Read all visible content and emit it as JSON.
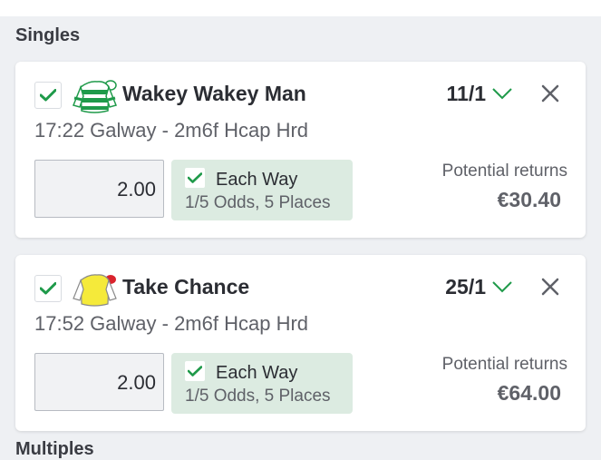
{
  "sections": {
    "singles_title": "Singles",
    "multiples_title": "Multiples"
  },
  "colors": {
    "accent_green": "#1f9a4a",
    "each_way_bg": "#dcebe1",
    "card_bg": "#ffffff",
    "page_bg": "#eef0f3"
  },
  "bets": [
    {
      "selected": true,
      "horse": "Wakey Wakey Man",
      "odds": "11/1",
      "race": "17:22 Galway - 2m6f Hcap Hrd",
      "stake": "2.00",
      "each_way": {
        "checked": true,
        "label": "Each Way",
        "terms": "1/5 Odds, 5 Places"
      },
      "returns_label": "Potential returns",
      "returns_value": "€30.40",
      "silk_icon": "jockey-silk-green-white-hoops-icon"
    },
    {
      "selected": true,
      "horse": "Take Chance",
      "odds": "25/1",
      "race": "17:52 Galway - 2m6f Hcap Hrd",
      "stake": "2.00",
      "each_way": {
        "checked": true,
        "label": "Each Way",
        "terms": "1/5 Odds, 5 Places"
      },
      "returns_label": "Potential returns",
      "returns_value": "€64.00",
      "silk_icon": "jockey-silk-yellow-red-cap-icon"
    }
  ]
}
